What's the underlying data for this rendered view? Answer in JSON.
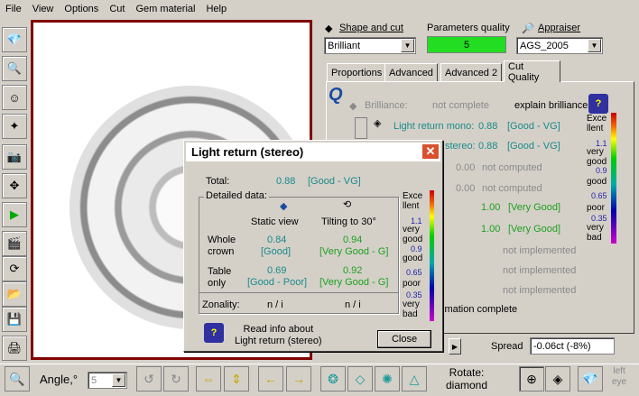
{
  "menu": {
    "file": "File",
    "view": "View",
    "options": "Options",
    "cut": "Cut",
    "gem": "Gem material",
    "help": "Help"
  },
  "top": {
    "shape_label": "Shape and cut",
    "shape_value": "Brilliant",
    "params_label": "Parameters quality",
    "params_value": "5",
    "appraiser_label": "Appraiser",
    "appraiser_value": "AGS_2005"
  },
  "tabs": [
    "Proportions",
    "Advanced",
    "Advanced 2",
    "Cut Quality"
  ],
  "cutquality": {
    "brilliance_label": "Brilliance:",
    "brilliance_value": "not complete",
    "explain": "explain brilliance",
    "mono_label": "Light return mono:",
    "mono_value": "0.88",
    "mono_grade": "[Good - VG]",
    "stereo_label": "stereo:",
    "stereo_value": "0.88",
    "stereo_grade": "[Good - VG]",
    "row3_value": "0.00",
    "row3_status": "not computed",
    "row4_value": "0.00",
    "row4_status": "not computed",
    "row5_value": "1.00",
    "row5_grade": "[Very Good]",
    "row6_value": "1.00",
    "row6_grade": "[Very Good]",
    "ni1": "not implemented",
    "ni2": "not implemented",
    "ni3": "not implemented",
    "estimation": "imation complete",
    "spread_label": "Spread",
    "spread_value": "-0.06ct (-8%)"
  },
  "scale": {
    "excellent": "Exce\nllent",
    "t1": "1.1",
    "verygood": "very\ngood",
    "t2": "0.9",
    "good": "good",
    "t3": "0.65",
    "poor": "poor",
    "t4": "0.35",
    "verybad": "very\nbad"
  },
  "dialog": {
    "title": "Light return (stereo)",
    "total_label": "Total:",
    "total_value": "0.88",
    "total_grade": "[Good - VG]",
    "detailed": "Detailed data:",
    "static": "Static view",
    "tilting": "Tilting to 30°",
    "whole_crown": "Whole\ncrown",
    "wc_static_val": "0.84",
    "wc_static_grade": "[Good]",
    "wc_tilt_val": "0.94",
    "wc_tilt_grade": "[Very Good - G]",
    "table_only": "Table\nonly",
    "to_static_val": "0.69",
    "to_static_grade": "[Good - Poor]",
    "to_tilt_val": "0.92",
    "to_tilt_grade": "[Very Good - G]",
    "zonality": "Zonality:",
    "zon_static": "n / i",
    "zon_tilt": "n / i",
    "read_info": "Read info about\nLight return (stereo)",
    "close": "Close"
  },
  "bottom": {
    "angle_label": "Angle,°",
    "angle_value": "5",
    "rotate_label": "Rotate:\ndiamond",
    "left_eye": "left\neye"
  }
}
